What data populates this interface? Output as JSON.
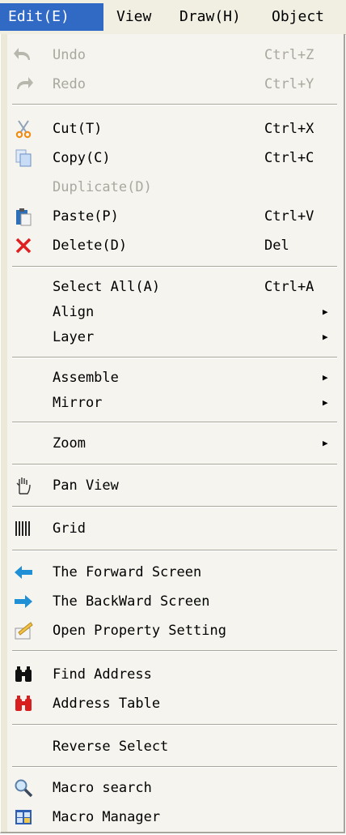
{
  "menubar": {
    "items": [
      {
        "label": "Edit(E)",
        "active": true
      },
      {
        "label": "View",
        "active": false
      },
      {
        "label": "Draw(H)",
        "active": false
      },
      {
        "label": "Object",
        "active": false
      }
    ]
  },
  "menu": {
    "undo": {
      "label": "Undo",
      "shortcut": "Ctrl+Z",
      "disabled": true,
      "icon": "undo-icon"
    },
    "redo": {
      "label": "Redo",
      "shortcut": "Ctrl+Y",
      "disabled": true,
      "icon": "redo-icon"
    },
    "cut": {
      "label": "Cut(T)",
      "shortcut": "Ctrl+X",
      "icon": "scissors-icon"
    },
    "copy": {
      "label": "Copy(C)",
      "shortcut": "Ctrl+C",
      "icon": "copy-icon"
    },
    "duplicate": {
      "label": "Duplicate(D)",
      "disabled": true
    },
    "paste": {
      "label": "Paste(P)",
      "shortcut": "Ctrl+V",
      "icon": "paste-icon"
    },
    "delete": {
      "label": "Delete(D)",
      "shortcut": "Del",
      "icon": "delete-x-icon"
    },
    "select_all": {
      "label": "Select All(A)",
      "shortcut": "Ctrl+A"
    },
    "align": {
      "label": "Align",
      "submenu": true
    },
    "layer": {
      "label": "Layer",
      "submenu": true
    },
    "assemble": {
      "label": "Assemble",
      "submenu": true
    },
    "mirror": {
      "label": "Mirror",
      "submenu": true
    },
    "zoom": {
      "label": "Zoom",
      "submenu": true
    },
    "pan_view": {
      "label": "Pan View",
      "icon": "hand-icon"
    },
    "grid": {
      "label": "Grid",
      "icon": "grid-icon"
    },
    "forward_screen": {
      "label": "The Forward Screen",
      "icon": "arrow-left-icon"
    },
    "backward_screen": {
      "label": "The BackWard Screen",
      "icon": "arrow-right-icon"
    },
    "open_property": {
      "label": "Open Property Setting",
      "icon": "property-icon"
    },
    "find_address": {
      "label": "Find Address",
      "icon": "binoculars-icon"
    },
    "address_table": {
      "label": "Address Table",
      "icon": "binoculars-red-icon"
    },
    "reverse_select": {
      "label": "Reverse Select"
    },
    "macro_search": {
      "label": "Macro search",
      "icon": "magnifier-icon"
    },
    "macro_manager": {
      "label": "Macro Manager",
      "icon": "macro-manager-icon"
    }
  },
  "submenu_arrow": "▶",
  "colors": {
    "highlight": "#316ac5",
    "disabled": "#a9a89f",
    "menu_bg": "#f5f4ee"
  }
}
